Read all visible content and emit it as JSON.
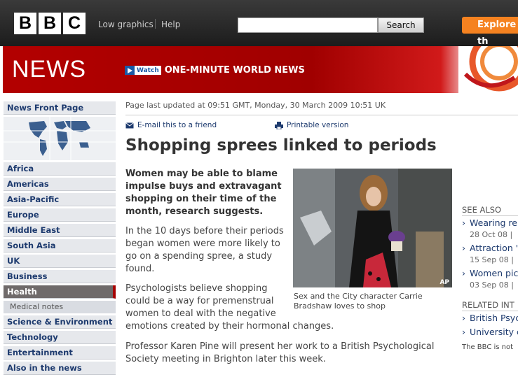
{
  "header": {
    "logo_letters": [
      "B",
      "B",
      "C"
    ],
    "low_graphics": "Low graphics",
    "help": "Help",
    "search_button": "Search",
    "explore": "Explore th"
  },
  "banner": {
    "title": "NEWS",
    "watch_label": "Watch",
    "one_minute": "ONE-MINUTE WORLD NEWS"
  },
  "nav": {
    "front_page": "News Front Page",
    "items": [
      "Africa",
      "Americas",
      "Asia-Pacific",
      "Europe",
      "Middle East",
      "South Asia",
      "UK",
      "Business"
    ],
    "active": "Health",
    "sub": "Medical notes",
    "more": [
      "Science & Environment",
      "Technology",
      "Entertainment",
      "Also in the news"
    ]
  },
  "article": {
    "updated": "Page last updated at 09:51 GMT, Monday, 30 March 2009 10:51 UK",
    "email": "E-mail this to a friend",
    "print": "Printable version",
    "headline": "Shopping sprees linked to periods",
    "intro": "Women may be able to blame impulse buys and extravagant shopping on their time of the month, research suggests.",
    "para1": "In the 10 days before their periods began women were more likely to go on a spending spree, a study found.",
    "para2_a": "Psychologists believe shopping",
    "para2_b": "could be a way for premenstrual",
    "para2_c": "women to deal with the negative",
    "para2_d": "emotions created by their hormonal changes.",
    "para3_a": "Professor Karen Pine will present her work to a British Psychological",
    "para3_b": "Society meeting in Brighton later this week.",
    "photo_credit": "AP",
    "caption": "Sex and the City character Carrie Bradshaw loves to shop"
  },
  "sidebar": {
    "see_also": "SEE ALSO",
    "links": [
      {
        "text": "Wearing re",
        "date": "28 Oct 08 |"
      },
      {
        "text": "Attraction '",
        "date": "15 Sep 08 |"
      },
      {
        "text": "Women pic",
        "date": "03 Sep 08 |"
      }
    ],
    "related": "RELATED INT",
    "related_links": [
      "British Psyc",
      "University c"
    ],
    "note": "The BBC is not"
  },
  "colors": {
    "bbc_red": "#a00000",
    "nav_blue": "#1d3a6e",
    "explore_orange": "#f58220"
  }
}
